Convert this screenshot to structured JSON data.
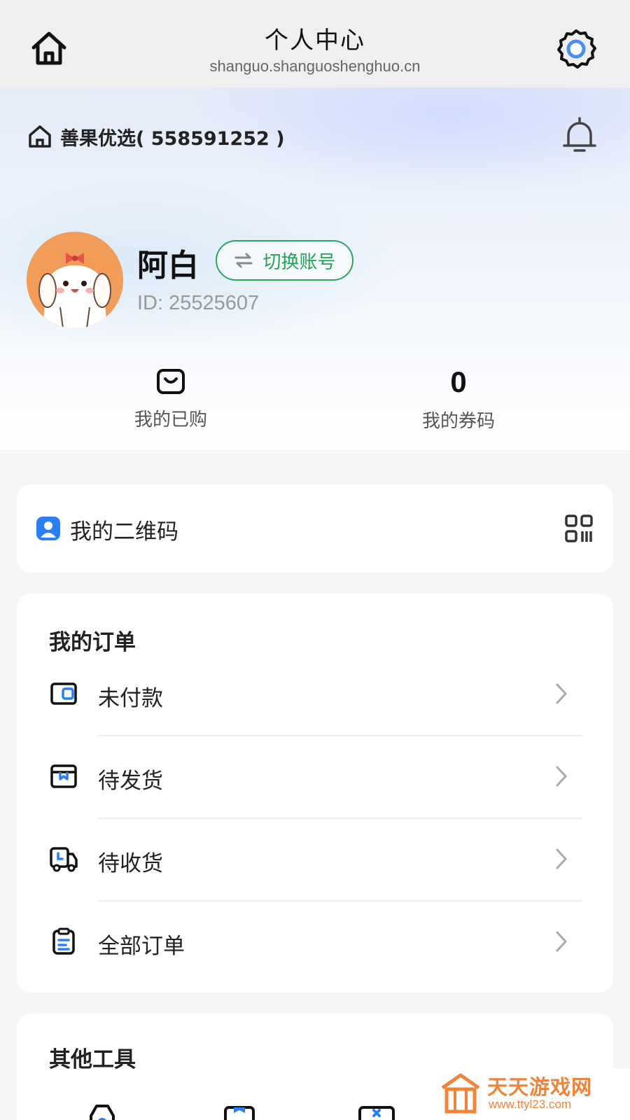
{
  "window": {
    "title": "个人中心",
    "url": "shanguo.shanguoshenghuo.cn"
  },
  "store": {
    "name": "善果优选( 558591252 )"
  },
  "profile": {
    "name": "阿白",
    "switch_label": "切换账号",
    "id_text": "ID: 25525607"
  },
  "stats": {
    "purchased_label": "我的已购",
    "coupons_count": "0",
    "coupons_label": "我的券码"
  },
  "qr": {
    "label": "我的二维码"
  },
  "orders": {
    "title": "我的订单",
    "items": [
      {
        "label": "未付款",
        "icon": "wallet-icon"
      },
      {
        "label": "待发货",
        "icon": "package-icon"
      },
      {
        "label": "待收货",
        "icon": "truck-icon"
      },
      {
        "label": "全部订单",
        "icon": "clipboard-icon"
      }
    ]
  },
  "tools": {
    "title": "其他工具"
  },
  "watermark": {
    "title": "天天游戏网",
    "url": "www.ttyl23.com"
  },
  "colors": {
    "accent_green": "#22a354",
    "accent_blue": "#2b7ff5",
    "watermark_orange": "#f08439"
  }
}
